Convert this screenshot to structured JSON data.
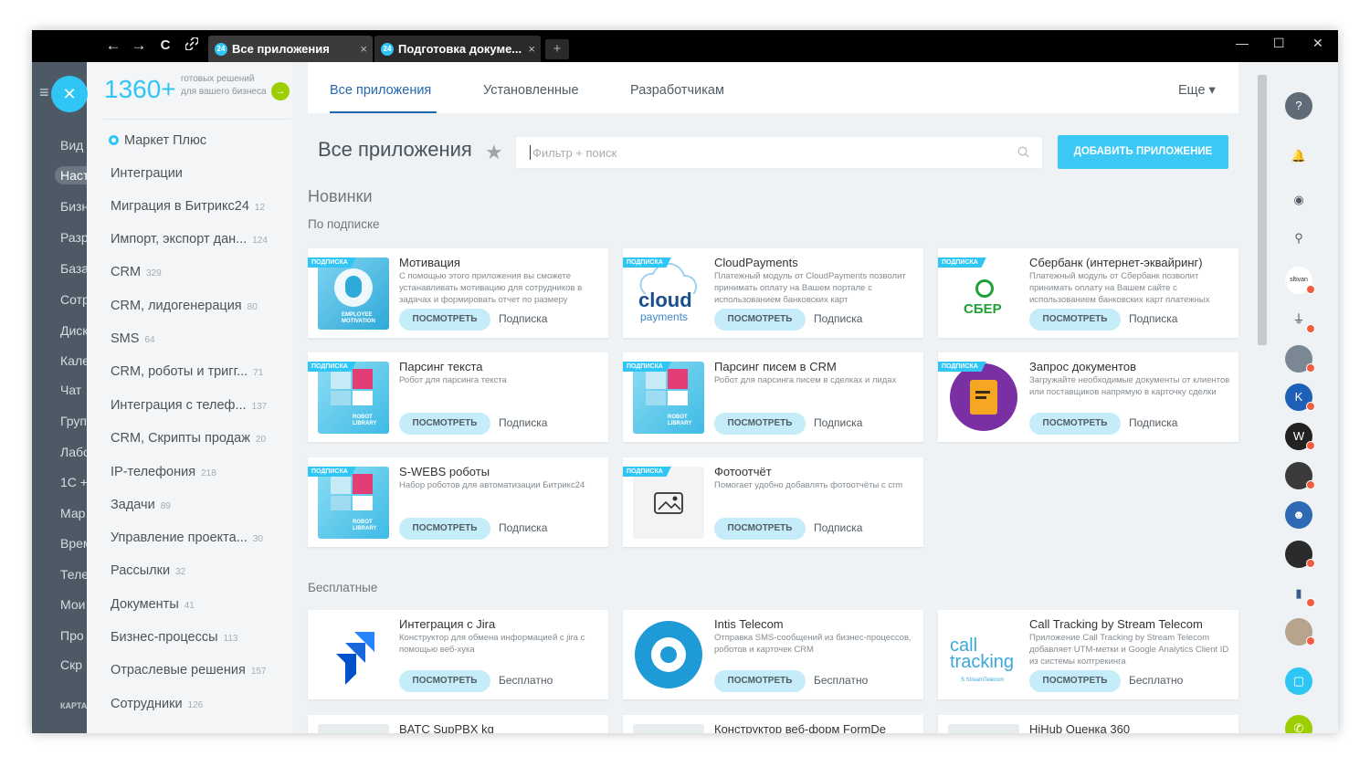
{
  "browser": {
    "nav": {
      "back": "←",
      "forward": "→",
      "reload": "C",
      "link": "🔗"
    },
    "tabs": [
      {
        "favicon": "24",
        "label": "Все приложения",
        "close": "×"
      },
      {
        "favicon": "24",
        "label": "Подготовка докуме...",
        "close": "×"
      }
    ],
    "new_tab": "+",
    "window_controls": {
      "minimize": "—",
      "maximize": "☐",
      "close": "✕"
    }
  },
  "leftnav": {
    "items": [
      "Вид",
      "Наст",
      "Бизн",
      "Разр",
      "База",
      "Сотр",
      "Диск",
      "Кале",
      "Чат",
      "Груп",
      "Лабо",
      "1С +",
      "Мар",
      "Врем",
      "Теле",
      "Мои",
      "Про",
      "Скр"
    ],
    "selected_index": 1,
    "footer": "КАРТА"
  },
  "sidebar": {
    "promo": {
      "number": "1360+",
      "text": "готовых решений для вашего бизнеса",
      "go": "→"
    },
    "categories": [
      {
        "label": "Маркет Плюс",
        "count": ""
      },
      {
        "label": "Интеграции",
        "count": ""
      },
      {
        "label": "Миграция в Битрикс24",
        "count": "12"
      },
      {
        "label": "Импорт, экспорт дан...",
        "count": "124"
      },
      {
        "label": "CRM",
        "count": "329"
      },
      {
        "label": "CRM, лидогенерация",
        "count": "80"
      },
      {
        "label": "SMS",
        "count": "64"
      },
      {
        "label": "CRM, роботы и тригг...",
        "count": "71"
      },
      {
        "label": "Интеграция с телеф...",
        "count": "137"
      },
      {
        "label": "CRM, Скрипты продаж",
        "count": "20"
      },
      {
        "label": "IP-телефония",
        "count": "218"
      },
      {
        "label": "Задачи",
        "count": "89"
      },
      {
        "label": "Управление проекта...",
        "count": "30"
      },
      {
        "label": "Рассылки",
        "count": "32"
      },
      {
        "label": "Документы",
        "count": "41"
      },
      {
        "label": "Бизнес-процессы",
        "count": "113"
      },
      {
        "label": "Отраслевые решения",
        "count": "157"
      },
      {
        "label": "Сотрудники",
        "count": "126"
      }
    ]
  },
  "main": {
    "tabs": [
      "Все приложения",
      "Установленные",
      "Разработчикам"
    ],
    "more": "Еще ▾",
    "title": "Все приложения",
    "search_placeholder": "Фильтр + поиск",
    "add_button": "ДОБАВИТЬ ПРИЛОЖЕНИЕ",
    "section_new": "Новинки",
    "section_subscription": "По подписке",
    "section_free": "Бесплатные",
    "badge": "ПОДПИСКА",
    "view_label": "ПОСМОТРЕТЬ",
    "cards": [
      {
        "title": "Мотивация",
        "desc": "С помощью этого приложения вы сможете устанавливать мотивацию для сотрудников в задачах и формировать отчет по размеру",
        "price": "Подписка",
        "badge": true,
        "icon": "employee-motivation-icon",
        "img_text": "EMPLOYEE MOTIVATION"
      },
      {
        "title": "CloudPayments",
        "desc": "Платежный модуль от CloudPayments позволит принимать оплату на Вашем портале с использованием банковских карт",
        "price": "Подписка",
        "badge": true,
        "icon": "cloudpayments-logo",
        "img_text": "cloud"
      },
      {
        "title": "Сбербанк (интернет-эквайринг)",
        "desc": "Платежный модуль от Сбербанк позволит принимать оплату на Вашем сайте с использованием банковских карт платежных",
        "price": "Подписка",
        "badge": true,
        "icon": "sber-logo",
        "img_text": "СБЕР"
      },
      {
        "title": "Парсинг текста",
        "desc": "Робот для парсинга текста",
        "price": "Подписка",
        "badge": true,
        "icon": "robot-library-icon",
        "img_text": "ROBOT LIBRARY"
      },
      {
        "title": "Парсинг писем в CRM",
        "desc": "Робот для парсинга писем в сделках и лидах",
        "price": "Подписка",
        "badge": true,
        "icon": "robot-library-icon",
        "img_text": "ROBOT LIBRARY"
      },
      {
        "title": "Запрос документов",
        "desc": "Загружайте необходимые документы от клиентов или поставщиков напрямую в карточку сделки",
        "price": "Подписка",
        "badge": true,
        "icon": "document-request-icon",
        "img_text": ""
      },
      {
        "title": "S-WEBS роботы",
        "desc": "Набор роботов для автоматизации Битрикс24",
        "price": "Подписка",
        "badge": true,
        "icon": "robot-library-icon",
        "img_text": "ROBOT LIBRARY"
      },
      {
        "title": "Фотоотчёт",
        "desc": "Помогает удобно добавлять фотоотчёты с crm",
        "price": "Подписка",
        "badge": true,
        "icon": "photo-report-icon",
        "img_text": ""
      },
      {
        "title": "Интеграция с Jira",
        "desc": "Конструктор для обмена информацией с jira с помощью веб-хука",
        "price": "Бесплатно",
        "badge": false,
        "icon": "jira-logo",
        "img_text": ""
      },
      {
        "title": "Intis Telecom",
        "desc": "Отправка SMS-сообщений из бизнес-процессов, роботов и карточек CRM",
        "price": "Бесплатно",
        "badge": false,
        "icon": "intis-logo",
        "img_text": ""
      },
      {
        "title": "Call Tracking by Stream Telecom",
        "desc": "Приложение Call Tracking by Stream Telecom добавляет UTM-метки и Google Analytics Client ID из системы колтрекинга",
        "price": "Бесплатно",
        "badge": false,
        "icon": "calltracking-logo",
        "img_text": "call tracking"
      },
      {
        "title": "BATC SupPBX kg",
        "desc": "",
        "price": "",
        "badge": false,
        "icon": "app-icon",
        "img_text": ""
      },
      {
        "title": "Конструктор веб-форм FormDe",
        "desc": "",
        "price": "",
        "badge": false,
        "icon": "app-icon",
        "img_text": ""
      },
      {
        "title": "HiHub Оценка 360",
        "desc": "",
        "price": "",
        "badge": false,
        "icon": "app-icon",
        "img_text": ""
      }
    ]
  },
  "rightbar": {
    "avatar_labels": [
      "sltivan",
      "",
      "",
      "",
      "",
      "",
      "",
      "",
      "",
      ""
    ],
    "colors": {
      "accent": "#2fc6f6",
      "notify": "#f25c3f",
      "call": "#9dcf00"
    }
  }
}
